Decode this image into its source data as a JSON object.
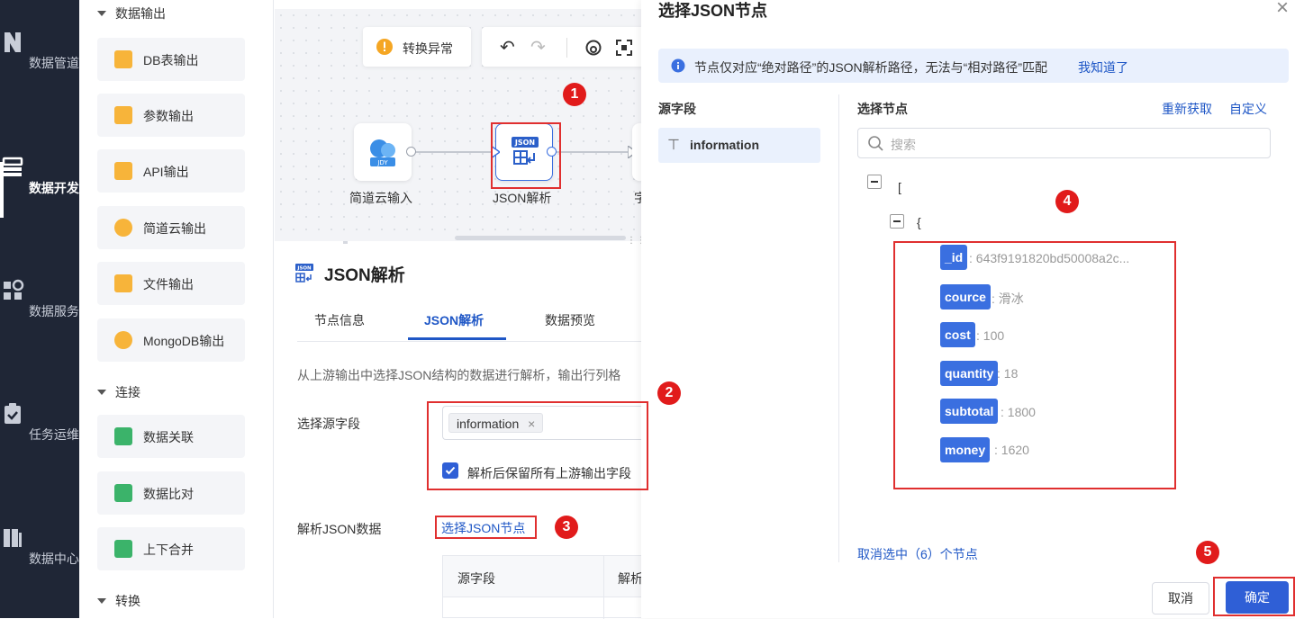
{
  "nav": {
    "items": [
      {
        "label": "数据管道",
        "icon": "pipeline-icon"
      },
      {
        "label": "数据开发",
        "icon": "dev-icon",
        "active": true
      },
      {
        "label": "数据服务",
        "icon": "service-icon"
      },
      {
        "label": "任务运维",
        "icon": "ops-icon"
      },
      {
        "label": "数据中心",
        "icon": "datacenter-icon"
      }
    ]
  },
  "palette": {
    "section_output": "数据输出",
    "output_items": [
      "DB表输出",
      "参数输出",
      "API输出",
      "简道云输出",
      "文件输出",
      "MongoDB输出"
    ],
    "section_connect": "连接",
    "connect_items": [
      "数据关联",
      "数据比对",
      "上下合并"
    ],
    "section_transform": "转换"
  },
  "canvas": {
    "status_text": "转换异常",
    "nodes": [
      {
        "label": "简道云输入",
        "icon_text": "JDY"
      },
      {
        "label": "JSON解析",
        "icon_text": "JSON"
      },
      {
        "label": "字"
      }
    ]
  },
  "panel": {
    "title": "JSON解析",
    "title_icon_text": "JSON",
    "tabs": [
      "节点信息",
      "JSON解析",
      "数据预览"
    ],
    "description": "从上游输出中选择JSON结构的数据进行解析，输出行列格",
    "source_field_label": "选择源字段",
    "source_field_tag": "information",
    "keep_fields_label": "解析后保留所有上游输出字段",
    "parse_label": "解析JSON数据",
    "select_node_link": "选择JSON节点",
    "table_headers": [
      "源字段",
      "解析"
    ]
  },
  "modal": {
    "title": "选择JSON节点",
    "info_text": "节点仅对应“绝对路径”的JSON解析路径，无法与“相对路径”匹配",
    "info_link": "我知道了",
    "source_col_title": "源字段",
    "source_field": "information",
    "node_col_title": "选择节点",
    "refresh_link": "重新获取",
    "custom_link": "自定义",
    "search_placeholder": "搜索",
    "tree": {
      "root_bracket": "[",
      "object_brace": "{",
      "fields": [
        {
          "key": "_id",
          "value": ": 643f9191820bd50008a2c..."
        },
        {
          "key": "cource",
          "value": ": 滑冰"
        },
        {
          "key": "cost",
          "value": ": 100"
        },
        {
          "key": "quantity",
          "value": ": 18"
        },
        {
          "key": "subtotal",
          "value": ": 1800"
        },
        {
          "key": "money",
          "value": ": 1620"
        }
      ]
    },
    "deselect_text": "取消选中（6）个节点",
    "cancel_button": "取消",
    "confirm_button": "确定"
  },
  "annotations": [
    "1",
    "2",
    "3",
    "4",
    "5"
  ],
  "colors": {
    "nav_bg": "#1f2636",
    "accent": "#1f57c6",
    "tag_blue": "#3a6fe0",
    "annotation_red": "#e11b1b"
  }
}
